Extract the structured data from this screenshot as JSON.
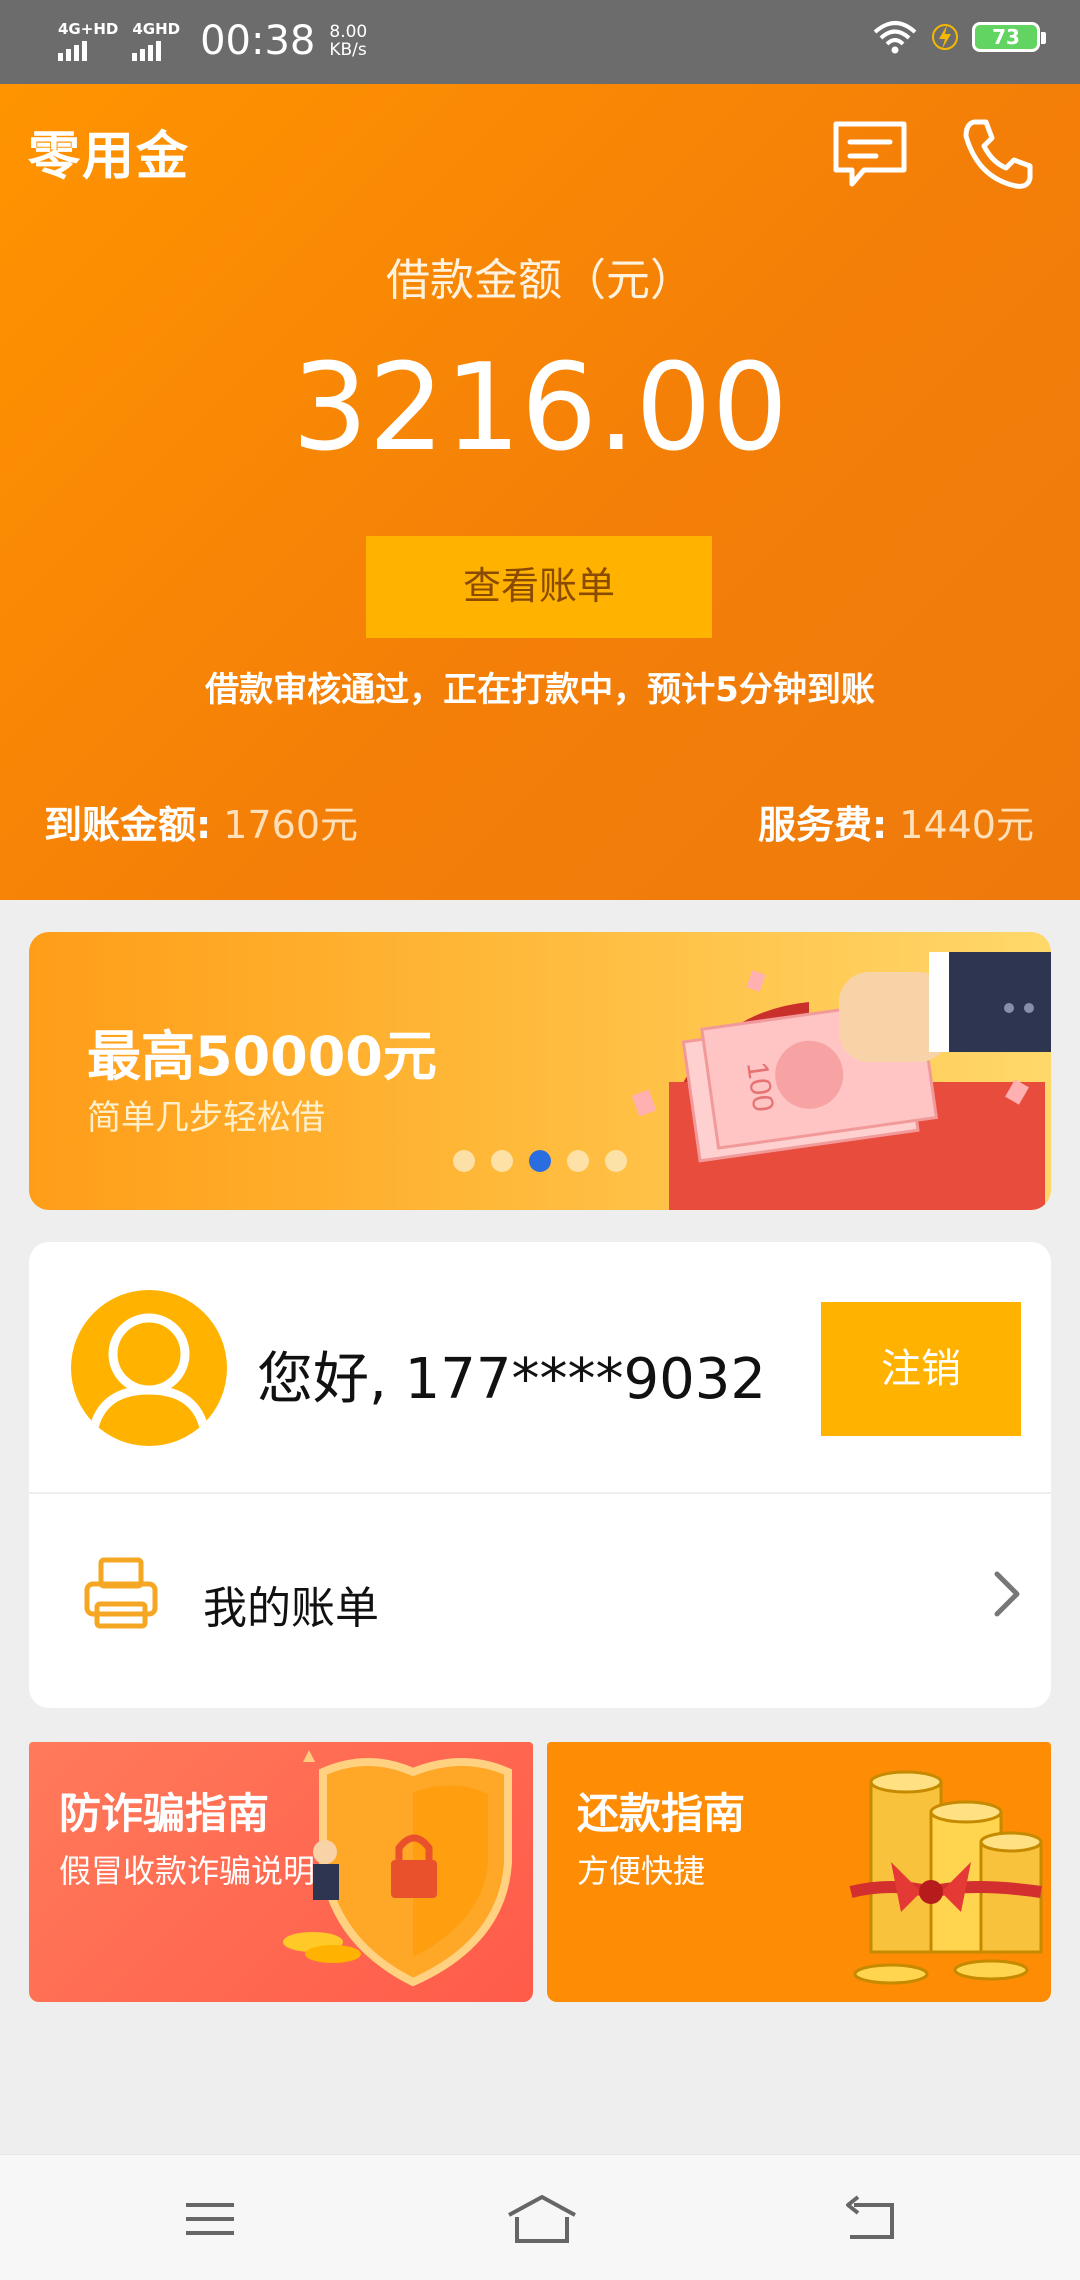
{
  "status_bar": {
    "net1": "4G+HD",
    "net2": "4GHD",
    "time": "00:38",
    "speed_value": "8.00",
    "speed_unit": "KB/s",
    "battery": "73",
    "icons": [
      "signal-icon",
      "wifi-icon",
      "charging-icon",
      "battery-icon"
    ]
  },
  "header": {
    "logo": "零用金",
    "loan_label": "借款金额（元）",
    "loan_amount": "3216.00",
    "bill_button": "查看账单",
    "status_text": "借款审核通过，正在打款中，预计5分钟到账",
    "received_label": "到账金额:",
    "received_value": "1760元",
    "fee_label": "服务费:",
    "fee_value": "1440元",
    "icons": [
      "message-icon",
      "phone-icon"
    ]
  },
  "banner": {
    "title": "最高50000元",
    "subtitle": "简单几步轻松借",
    "dots": 5,
    "active_dot": 3
  },
  "user": {
    "greeting": "您好, 177****9032",
    "logout_button": "注销",
    "my_bills": "我的账单"
  },
  "guides": [
    {
      "title": "防诈骗指南",
      "subtitle": "假冒收款诈骗说明"
    },
    {
      "title": "还款指南",
      "subtitle": "方便快捷"
    }
  ],
  "colors": {
    "accent_orange": "#f47f08",
    "button_yellow": "#ffb300",
    "fraud_card": "#ff5b4a",
    "active_dot": "#2a6de1"
  },
  "nav": [
    "menu-icon",
    "home-icon",
    "back-icon"
  ]
}
